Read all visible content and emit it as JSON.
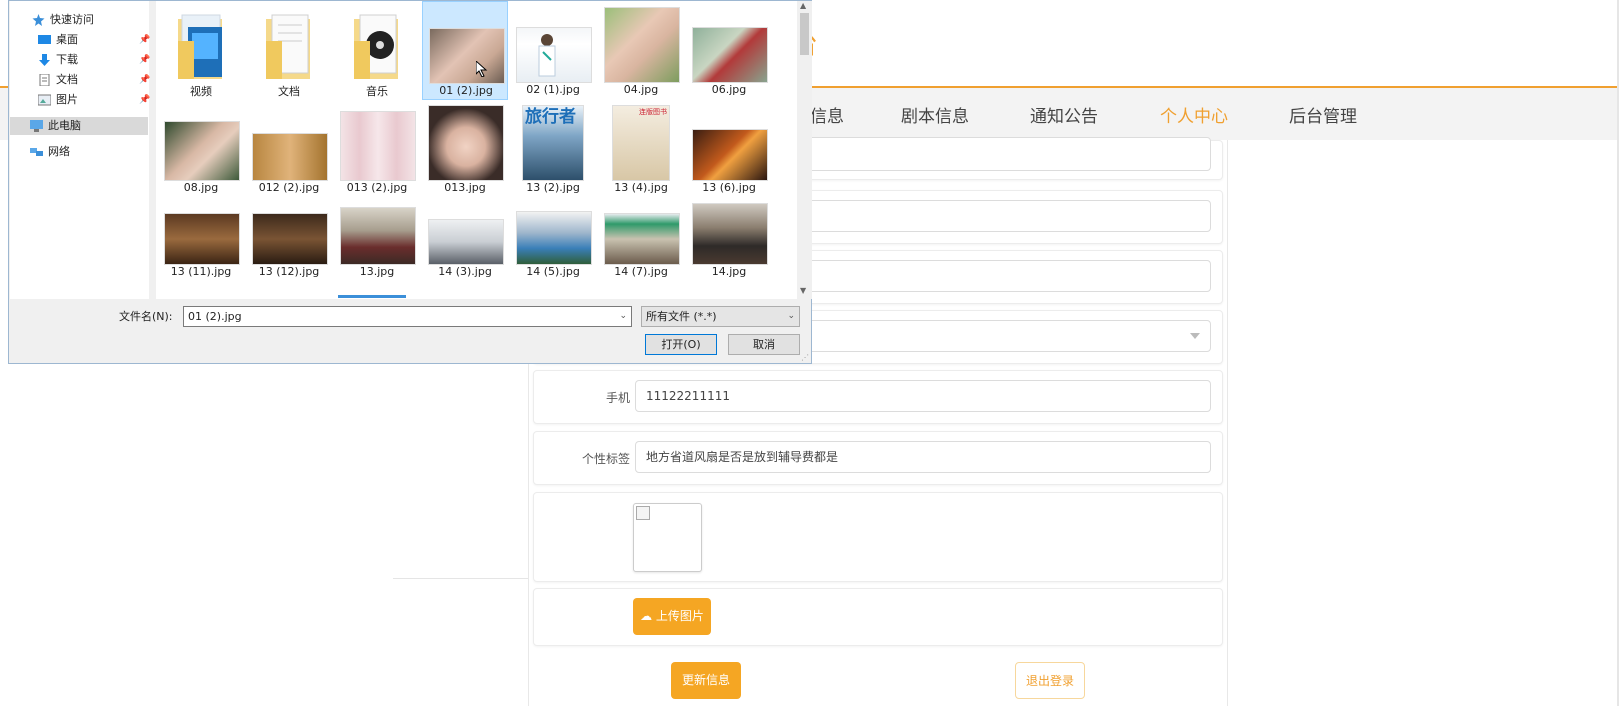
{
  "site": {
    "title_fragment": "台"
  },
  "nav": {
    "items": [
      {
        "label": "信息"
      },
      {
        "label": "剧本信息"
      },
      {
        "label": "通知公告"
      },
      {
        "label": "个人中心"
      },
      {
        "label": "后台管理"
      }
    ],
    "active": "个人中心"
  },
  "form": {
    "phone_label": "手机",
    "phone_value": "11122211111",
    "tag_label": "个性标签",
    "tag_value": "地方省道风扇是否是放到辅导费都是",
    "upload_label": "上传图片",
    "update_label": "更新信息",
    "logout_label": "退出登录"
  },
  "dialog": {
    "nav_pane": {
      "quick_access": "快速访问",
      "items": [
        "桌面",
        "下载",
        "文档",
        "图片"
      ],
      "this_pc": "此电脑",
      "network": "网络"
    },
    "files": [
      {
        "name": "视频",
        "kind": "folder"
      },
      {
        "name": "文档",
        "kind": "folder"
      },
      {
        "name": "音乐",
        "kind": "folder"
      },
      {
        "name": "01 (2).jpg",
        "kind": "image",
        "selected": true
      },
      {
        "name": "02 (1).jpg",
        "kind": "image"
      },
      {
        "name": "04.jpg",
        "kind": "image"
      },
      {
        "name": "06.jpg",
        "kind": "image"
      },
      {
        "name": "08.jpg",
        "kind": "image"
      },
      {
        "name": "012 (2).jpg",
        "kind": "image"
      },
      {
        "name": "013 (2).jpg",
        "kind": "image"
      },
      {
        "name": "013.jpg",
        "kind": "image"
      },
      {
        "name": "13 (2).jpg",
        "kind": "image"
      },
      {
        "name": "13 (4).jpg",
        "kind": "image"
      },
      {
        "name": "13 (6).jpg",
        "kind": "image"
      },
      {
        "name": "13 (11).jpg",
        "kind": "image"
      },
      {
        "name": "13 (12).jpg",
        "kind": "image"
      },
      {
        "name": "13.jpg",
        "kind": "image"
      },
      {
        "name": "14 (3).jpg",
        "kind": "image"
      },
      {
        "name": "14 (5).jpg",
        "kind": "image"
      },
      {
        "name": "14 (7).jpg",
        "kind": "image"
      },
      {
        "name": "14.jpg",
        "kind": "image"
      }
    ],
    "filename_label": "文件名(N):",
    "filename_value": "01 (2).jpg",
    "filetype_value": "所有文件 (*.*)",
    "open_label": "打开(O)",
    "cancel_label": "取消",
    "thumb_text": {
      "magazine": "旅行者",
      "book": "连版图书"
    }
  },
  "colors": {
    "accent": "#f5a623",
    "accent_text": "#f0a030",
    "dialog_border": "#9db7d1",
    "selection_bg": "#cce8ff"
  }
}
